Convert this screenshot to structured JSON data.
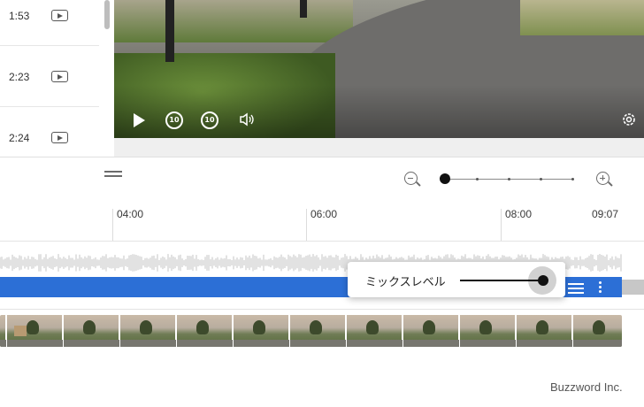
{
  "clip_list": {
    "items": [
      {
        "duration": "1:53",
        "icon": "video-icon"
      },
      {
        "duration": "2:23",
        "icon": "video-icon"
      },
      {
        "duration": "2:24",
        "icon": "video-icon"
      }
    ]
  },
  "player": {
    "controls": [
      "play-icon",
      "replay-10-icon",
      "forward-10-icon",
      "volume-icon",
      "settings-icon"
    ],
    "replay_label": "10",
    "forward_label": "10"
  },
  "timeline": {
    "ruler_ticks": [
      "04:00",
      "06:00",
      "08:00",
      "09:07"
    ],
    "zoom": {
      "level": 0
    }
  },
  "popup": {
    "label": "ミックスレベル",
    "level": 1.0
  },
  "colors": {
    "accent": "#2c6fd6"
  },
  "watermark": "Buzzword Inc."
}
